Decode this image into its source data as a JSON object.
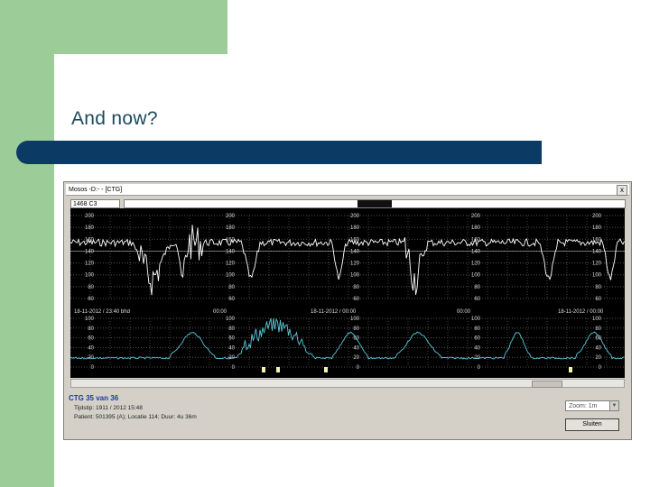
{
  "slide": {
    "title": "And now?"
  },
  "window": {
    "caption": "Mosos -D:- - [CTG]",
    "close_glyph": "x",
    "toolbar_field": "1468 C3"
  },
  "chart": {
    "left_axis_upper": [
      "200",
      "180",
      "160",
      "140",
      "120",
      "100",
      "80",
      "60"
    ],
    "left_axis_lower": [
      "100",
      "80",
      "60",
      "40",
      "20",
      "0"
    ],
    "mid_axis_upper": [
      "200",
      "180",
      "160",
      "140",
      "120",
      "100",
      "80",
      "60"
    ],
    "mid_axis_lower": [
      "100",
      "80",
      "60",
      "40",
      "20",
      "0"
    ],
    "time_labels": [
      "18-11-2012 / 23:40 bhd",
      "00:00",
      "18-11-2012 / 00:00",
      "00:00",
      "18-11-2012 / 00:00"
    ]
  },
  "info": {
    "title": "CTG 35 van 36",
    "line1": "Tijdstip: 1911 / 2012 15:48",
    "line2": "Patient: 501395 (A); Locatie 114; Duur: 4u 36m",
    "dropdown_value": "Zoom: 1m",
    "close_button": "Sluiten"
  }
}
